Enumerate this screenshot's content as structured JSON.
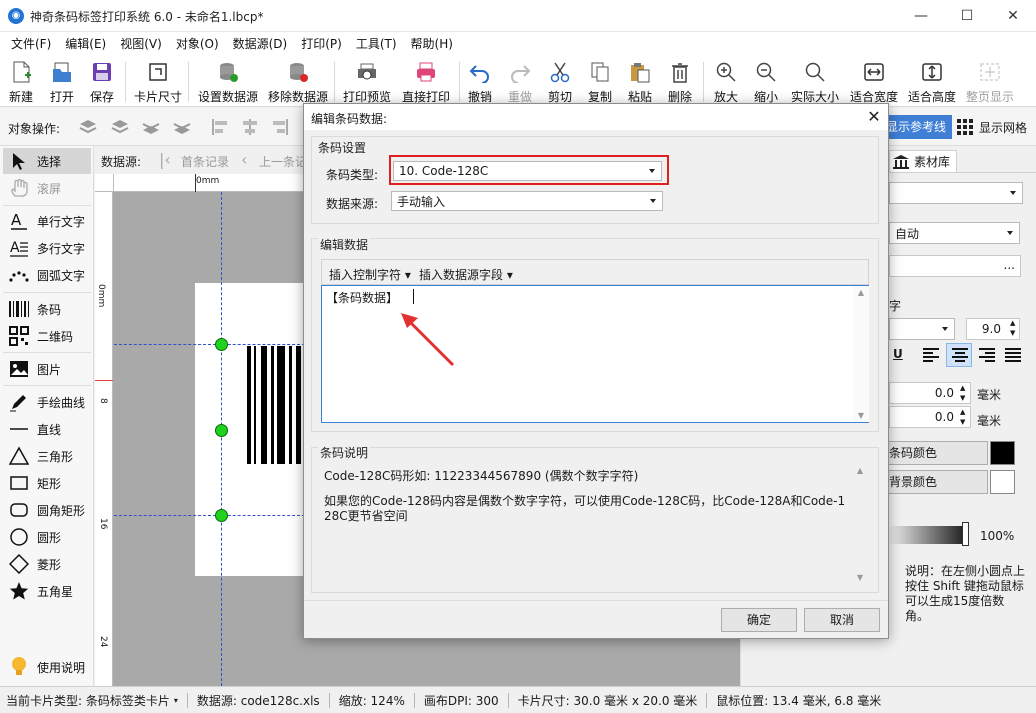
{
  "window": {
    "title": "神奇条码标签打印系统 6.0 - 未命名1.lbcp*",
    "minimize": "—",
    "maximize": "☐",
    "close": "✕"
  },
  "menu": [
    "文件(F)",
    "编辑(E)",
    "视图(V)",
    "对象(O)",
    "数据源(D)",
    "打印(P)",
    "工具(T)",
    "帮助(H)"
  ],
  "toolbar": {
    "new": "新建",
    "open": "打开",
    "save": "保存",
    "card_size": "卡片尺寸",
    "set_datasource": "设置数据源",
    "remove_datasource": "移除数据源",
    "print_preview": "打印预览",
    "direct_print": "直接打印",
    "undo": "撤销",
    "redo": "重做",
    "cut": "剪切",
    "copy": "复制",
    "paste": "粘贴",
    "delete": "删除",
    "zoom_in": "放大",
    "zoom_out": "缩小",
    "actual_size": "实际大小",
    "fit_width": "适合宽度",
    "fit_height": "适合高度",
    "full_page": "整页显示"
  },
  "object_bar": {
    "label": "对象操作:",
    "show_guides": "显示参考线",
    "show_grid": "显示网格"
  },
  "tools": {
    "select": "选择",
    "scroll": "滚屏",
    "single_text": "单行文字",
    "multi_text": "多行文字",
    "arc_text": "圆弧文字",
    "barcode": "条码",
    "qrcode": "二维码",
    "image": "图片",
    "freehand": "手绘曲线",
    "line": "直线",
    "triangle": "三角形",
    "rect": "矩形",
    "round_rect": "圆角矩形",
    "ellipse": "圆形",
    "diamond": "菱形",
    "star": "五角星",
    "help": "使用说明"
  },
  "nav": {
    "datasource_label": "数据源:",
    "first": "首条记录",
    "prev": "上一条记"
  },
  "rulers": {
    "top_zero": "0mm",
    "left_marks": [
      "0mm",
      "8",
      "16",
      "24"
    ]
  },
  "right_panel": {
    "material_tab": "素材库",
    "auto_value": "自动",
    "more_btn": "...",
    "font_label": "字",
    "font_size": "9.0",
    "underline": "U",
    "offset_x": "0.0",
    "offset_y": "0.0",
    "unit1": "毫米",
    "unit2": "毫米",
    "bar_color": "条码颜色",
    "bg_color": "背景颜色",
    "opacity": "100%",
    "hint": "说明：在左侧小圆点上按住 Shift 键拖动鼠标可以生成15度倍数角。",
    "bar_color_hex": "#000000",
    "bg_color_hex": "#ffffff"
  },
  "dialog": {
    "title": "编辑条码数据:",
    "close": "✕",
    "settings_group": "条码设置",
    "type_label": "条码类型:",
    "type_value": "10. Code-128C",
    "source_label": "数据来源:",
    "source_value": "手动输入",
    "edit_group": "编辑数据",
    "insert_control": "插入控制字符",
    "insert_field": "插入数据源字段",
    "data_text": "【条码数据】",
    "desc_group": "条码说明",
    "desc_line1": "Code-128C码形如: 11223344567890 (偶数个数字字符)",
    "desc_line2": "如果您的Code-128码内容是偶数个数字字符，可以使用Code-128C码，比Code-128A和Code-128C更节省空间",
    "ok": "确定",
    "cancel": "取消",
    "highlight_color": "#e02020"
  },
  "status": {
    "card_type": "当前卡片类型: 条码标签类卡片",
    "datasource": "数据源: code128c.xls",
    "zoom": "缩放: 124%",
    "dpi": "画布DPI: 300",
    "card_size": "卡片尺寸: 30.0 毫米 x 20.0 毫米",
    "mouse_pos": "鼠标位置: 13.4 毫米, 6.8 毫米"
  }
}
